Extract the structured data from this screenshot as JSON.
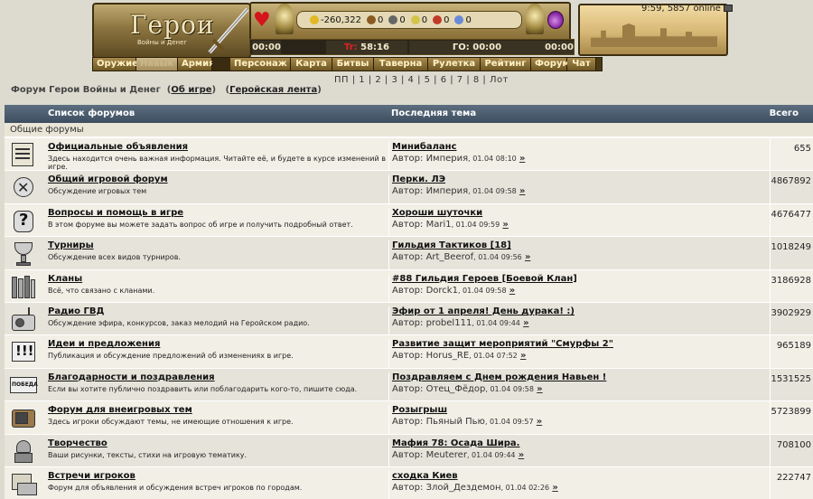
{
  "header": {
    "logo_title": "Герои",
    "logo_subtitle": "Войны и Денег",
    "online_info": "9:59, 5857 online",
    "resources": [
      "-260,322",
      "0",
      "0",
      "0",
      "0",
      "0"
    ],
    "timers": {
      "left": "00:00",
      "hp_label": "Tr:",
      "hp_value": "58:16",
      "go": "ГО: 00:00",
      "right": "00:00"
    }
  },
  "nav": [
    "Оружие",
    "Навык",
    "Армия",
    "Персонаж",
    "Карта",
    "Битвы",
    "Таверна",
    "Рулетка",
    "Рейтинг",
    "Форум",
    "Чат"
  ],
  "pages": "ПП | 1 | 2 | 3 | 4 | 5 | 6 | 7 | 8 | Лот",
  "breadcrumb": {
    "title": "Форум Герои Войны и Денег",
    "link1": "Об игре",
    "link2": "Геройская лента"
  },
  "table": {
    "col_forums": "Список форумов",
    "col_last": "Последняя тема",
    "col_total": "Всего",
    "section": "Общие форумы",
    "author_label": "Автор: ",
    "go_mark": "»",
    "rows": [
      {
        "name": "Официальные объявления",
        "desc": "Здесь находится очень важная информация. Читайте её, и будете в курсе изменений в игре.",
        "topic": "Минибаланс",
        "author": "Империя",
        "time": ", 01.04 08:10",
        "count": "655",
        "icon": "scroll-icon"
      },
      {
        "name": "Общий игровой форум",
        "desc": "Обсуждение игровых тем",
        "topic": "Перки. ЛЭ",
        "author": "Империя",
        "time": ", 01.04 09:58",
        "count": "4867892",
        "icon": "swords-icon"
      },
      {
        "name": "Вопросы и помощь в игре",
        "desc": "В этом форуме вы можете задать вопрос об игре и получить подробный ответ.",
        "topic": "Хороши шуточки",
        "author": "Mari1",
        "time": ", 01.04 09:59",
        "count": "4676477",
        "icon": "question-icon"
      },
      {
        "name": "Турниры",
        "desc": "Обсуждение всех видов турниров.",
        "topic": "Гильдия Тактиков [18]",
        "author": "Art_Beerof",
        "time": ", 01.04 09:56",
        "count": "1018249",
        "icon": "trophy-icon"
      },
      {
        "name": "Кланы",
        "desc": "Всё, что связано с кланами.",
        "topic": "#88 Гильдия Героев [Боевой Клан]",
        "author": "Dorck1",
        "time": ", 01.04 09:58",
        "count": "3186928",
        "icon": "books-icon"
      },
      {
        "name": "Радио ГВД",
        "desc": "Обсуждение эфира, конкурсов, заказ мелодий на Геройском радио.",
        "topic": "Эфир от 1 апреля! День дурака! :)",
        "author": "probel111",
        "time": ", 01.04 09:44",
        "count": "3902929",
        "icon": "radio-icon"
      },
      {
        "name": "Идеи и предложения",
        "desc": "Публикация и обсуждение предложений об изменениях в игре.",
        "topic": "Развитие защит мероприятий \"Смурфы 2\"",
        "author": "Horus_RE",
        "time": ", 01.04 07:52",
        "count": "965189",
        "icon": "exclamation-icon"
      },
      {
        "name": "Благодарности и поздравления",
        "desc": "Если вы хотите публично поздравить или поблагодарить кого-то, пишите сюда.",
        "topic": "Поздравляем с Днем рождения Навьен !",
        "author": "Отец_Фёдор",
        "time": ", 01.04 09:58",
        "count": "1531525",
        "icon": "victory-icon",
        "icon_text": "ПОБЕДА"
      },
      {
        "name": "Форум для внеигровых тем",
        "desc": "Здесь игроки обсуждают темы, не имеющие отношения к игре.",
        "topic": "Розыгрыш",
        "author": "Пьяный Пью",
        "time": ", 01.04 09:57",
        "count": "5723899",
        "icon": "tv-icon"
      },
      {
        "name": "Творчество",
        "desc": "Ваши рисунки, тексты, стихи на игровую тематику.",
        "topic": "Мафия 78: Осада Шира.",
        "author": "Meuterer",
        "time": ", 01.04 09:44",
        "count": "708100",
        "icon": "knight-icon"
      },
      {
        "name": "Встречи игроков",
        "desc": "Форум для объявления и обсуждения встреч игроков по городам.",
        "topic": "сходка Киев",
        "author": "Злой_Дездемон",
        "time": ", 01.04 02:26",
        "count": "222747",
        "icon": "meeting-icon"
      }
    ]
  }
}
